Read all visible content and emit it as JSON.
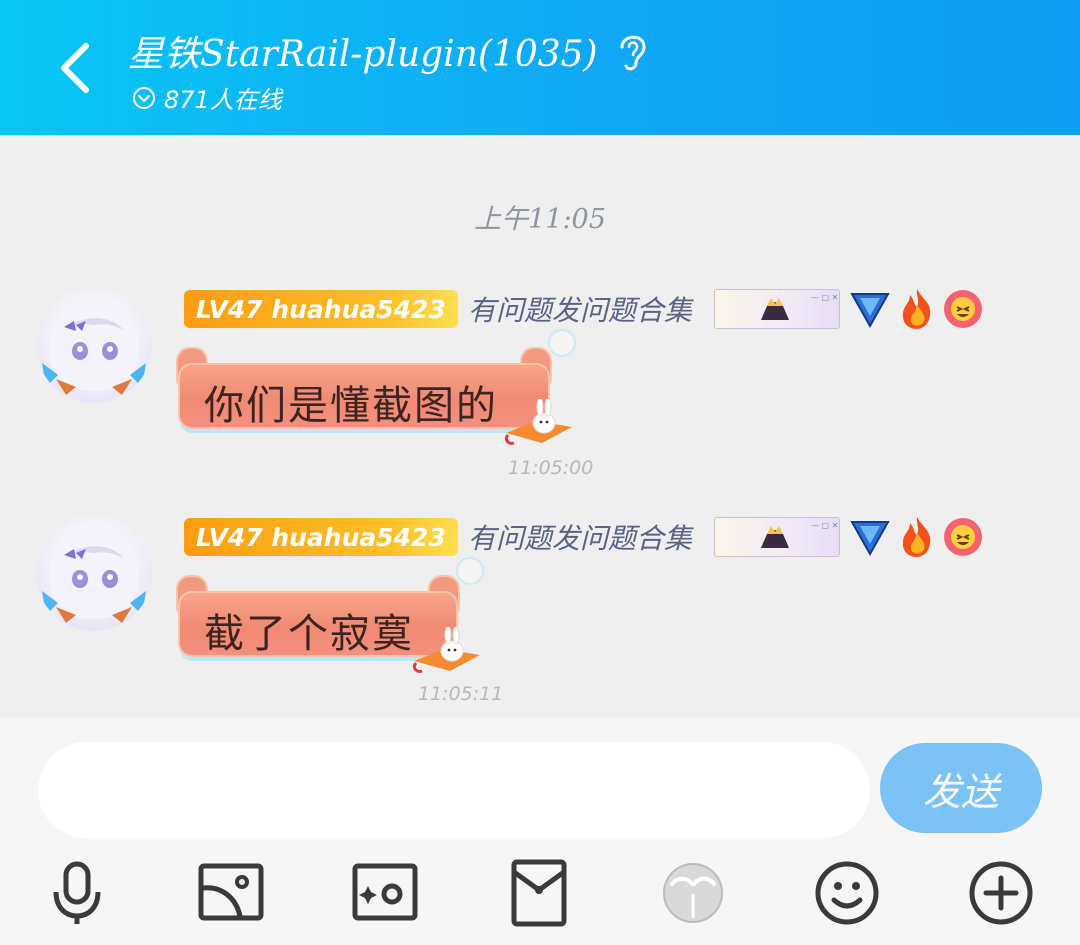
{
  "header": {
    "title": "星铁StarRail-plugin(1035)",
    "online_text": "871人在线"
  },
  "chat": {
    "time_divider": "上午11:05",
    "messages": [
      {
        "level": "LV47 huahua5423",
        "group_title": "有问题发问题合集",
        "text": "你们是懂截图的",
        "time": "11:05:00"
      },
      {
        "level": "LV47 huahua5423",
        "group_title": "有问题发问题合集",
        "text": "截了个寂寞",
        "time": "11:05:11"
      }
    ]
  },
  "input": {
    "placeholder": "",
    "send_label": "发送"
  },
  "toolbar": {
    "icons": [
      "microphone-icon",
      "image-icon",
      "camera-icon",
      "red-packet-icon",
      "avatar-face-icon",
      "emoji-icon",
      "plus-icon"
    ]
  },
  "colors": {
    "header_start": "#08c6f5",
    "header_end": "#0f9cf2",
    "send_button": "#7cc2f4",
    "level_badge": "#fb9d10",
    "bubble": "#f08a74"
  }
}
